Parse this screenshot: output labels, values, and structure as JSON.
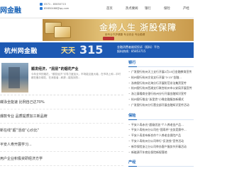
{
  "header": {
    "logo": "网金融",
    "phone": "0571 - 85850715",
    "email": "85850468@qq.com",
    "nav": [
      "首页",
      "热点要闻",
      "银行",
      "保险",
      "产经"
    ]
  },
  "banner_gold": {
    "headline": "金榜人生 浙股保障",
    "subline": "用专业守护健康 专业安全 专业稳健"
  },
  "banner_blue": {
    "title": "杭州网金融",
    "tianTian": "天天",
    "number": "315",
    "info_line1": "金融消费者维权投诉（报料）平台",
    "info_line2": "报料热线：85853715"
  },
  "sections": {
    "bank": {
      "title": "银行",
      "items": [
        "广发银行杭州天工支行开展2月15日金融教育宣传",
        "杭州银行杭州文化支行开展“3·15”金融...",
        "浙商银行杭州北海分行开展防范非法集资宣传",
        "杭州银行杭州西湖支行联合杭州市公安局开展宣传",
        "浙江泰隆商业银行杭州分行开展金融知识宣传",
        "杭州银行推出“浙里贷”小微金融服务新模式",
        "广发银行杭州分行营业部开展金融知识宣传活动"
      ]
    },
    "insurance": {
      "title": "保险",
      "items": [
        "平安人寿赤光“超级优选”个人养老金产品...",
        "平安人寿杭州分公司在“国寿杯”业务竞赛中...",
        "平安人寿发布新合作个人养老金保险产品",
        "平安人寿杭州分公司举行“反洗钱”宣传活动",
        "新华保险浙江分公司举办客户服务节开幕活动",
        "新能源汽车商业保险新规落地"
      ]
    },
    "industry": {
      "title": "产经",
      "items": []
    }
  },
  "feature": {
    "title": "顺发经济，“层层”的烟花产业",
    "desc": "今年全市的烟花，“顺发经济”引导力度加大，市场能见度大增。在市场上和...平时都在备办烟花，在消费者...和那...能找到的..."
  },
  "left_list": [
    "蝶泳全能速 比例自己达70%",
    "爆款专业 品质提质加工新品牌",
    "新在线“超”活动“心价比”",
    "平安人寿开展学习...",
    "用户企业积极资研经济方学"
  ]
}
